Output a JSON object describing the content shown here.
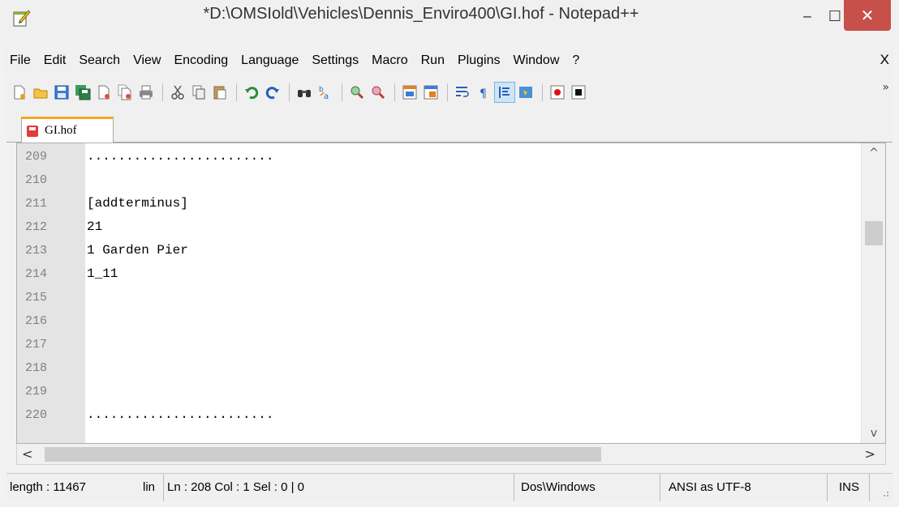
{
  "window": {
    "title": "*D:\\OMSIold\\Vehicles\\Dennis_Enviro400\\GI.hof - Notepad++",
    "minimize_glyph": "‒",
    "maximize_glyph": "☐",
    "close_glyph": "✕"
  },
  "menu": {
    "items": [
      "File",
      "Edit",
      "Search",
      "View",
      "Encoding",
      "Language",
      "Settings",
      "Macro",
      "Run",
      "Plugins",
      "Window",
      "?"
    ],
    "close_glyph": "X"
  },
  "toolbar": {
    "icons": [
      "new-file-icon",
      "open-file-icon",
      "save-icon",
      "save-all-icon",
      "close-icon",
      "close-all-icon",
      "print-icon",
      "cut-icon",
      "copy-icon",
      "paste-icon",
      "undo-icon",
      "redo-icon",
      "find-icon",
      "replace-icon",
      "zoom-in-icon",
      "zoom-out-icon",
      "sync-vertical-icon",
      "sync-horizontal-icon",
      "word-wrap-icon",
      "show-all-chars-icon",
      "indent-guide-icon",
      "user-language-icon",
      "record-macro-icon",
      "stop-macro-icon"
    ],
    "overflow_glyph": "»"
  },
  "tabs": [
    {
      "label": "GI.hof",
      "active": true,
      "unsaved": true
    }
  ],
  "editor": {
    "lines": [
      {
        "num": "209",
        "text": "........................"
      },
      {
        "num": "210",
        "text": ""
      },
      {
        "num": "211",
        "text": "[addterminus]"
      },
      {
        "num": "212",
        "text": "21"
      },
      {
        "num": "213",
        "text": "1 Garden Pier"
      },
      {
        "num": "214",
        "text": "1_11"
      },
      {
        "num": "215",
        "text": ""
      },
      {
        "num": "216",
        "text": ""
      },
      {
        "num": "217",
        "text": ""
      },
      {
        "num": "218",
        "text": ""
      },
      {
        "num": "219",
        "text": ""
      },
      {
        "num": "220",
        "text": "........................"
      }
    ],
    "scroll_up_glyph": "^",
    "scroll_down_glyph": "v",
    "scroll_left_glyph": "<",
    "scroll_right_glyph": ">"
  },
  "statusbar": {
    "length": "length : 11467",
    "lines_truncated": "lin",
    "position": "Ln : 208    Col : 1    Sel : 0 | 0",
    "eol": "Dos\\Windows",
    "encoding": "ANSI as UTF-8",
    "mode": "INS"
  },
  "colors": {
    "close_button": "#c7504a",
    "tab_accent": "#f5a623",
    "gutter": "#e4e4e4",
    "line_number": "#808080"
  }
}
